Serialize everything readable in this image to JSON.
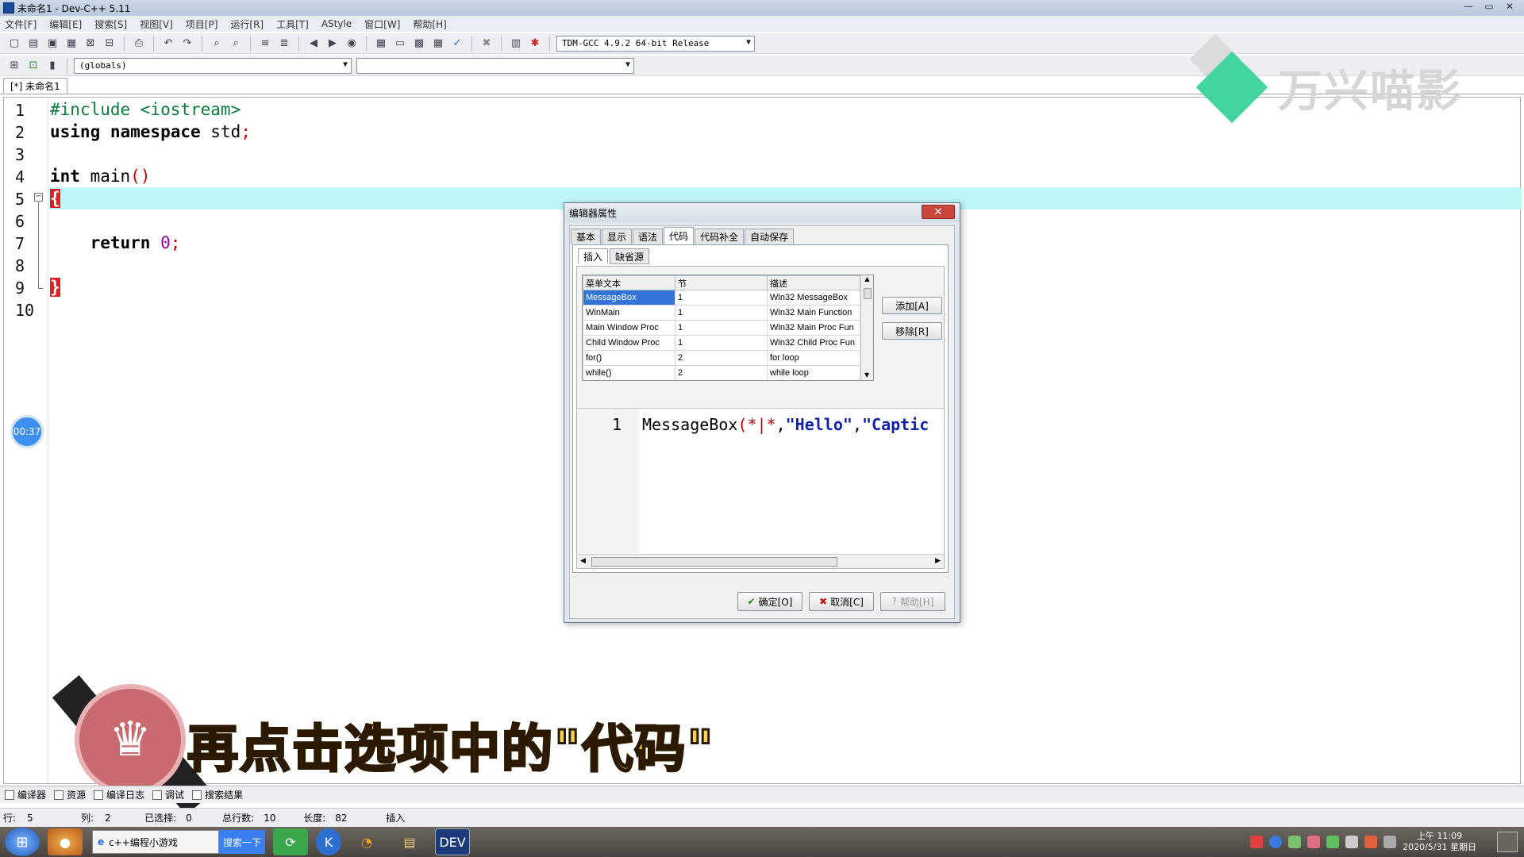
{
  "window": {
    "title": "未命名1 - Dev-C++ 5.11",
    "buttons": [
      "—",
      "▭",
      "✕"
    ]
  },
  "menu": [
    "文件[F]",
    "编辑[E]",
    "搜索[S]",
    "视图[V]",
    "项目[P]",
    "运行[R]",
    "工具[T]",
    "AStyle",
    "窗口[W]",
    "帮助[H]"
  ],
  "toolbar": {
    "compiler": "TDM-GCC 4.9.2 64-bit Release",
    "scope": "(globals)"
  },
  "editor": {
    "tab": "[*] 未命名1",
    "lines": [
      {
        "n": "1"
      },
      {
        "n": "2"
      },
      {
        "n": "3"
      },
      {
        "n": "4"
      },
      {
        "n": "5"
      },
      {
        "n": "6"
      },
      {
        "n": "7"
      },
      {
        "n": "8"
      },
      {
        "n": "9"
      },
      {
        "n": "10"
      }
    ],
    "code": {
      "l1": "#include <iostream>",
      "l2_kw": "using namespace",
      "l2_rest": " std",
      "l2_semi": ";",
      "l4_kw": "int",
      "l4_rest": " main",
      "l4_paren": "()",
      "l5": "{",
      "l7_kw": "return",
      "l7_num": "0",
      "l7_semi": ";",
      "l9": "}"
    },
    "timer": "00:37"
  },
  "watermark": "万兴喵影",
  "dialog": {
    "title": "编辑器属性",
    "close": "✕",
    "tabs": [
      "基本",
      "显示",
      "语法",
      "代码",
      "代码补全",
      "自动保存"
    ],
    "active_tab": "代码",
    "subtabs": [
      "插入",
      "缺省源"
    ],
    "table": {
      "headers": [
        "菜单文本",
        "节",
        "描述"
      ],
      "rows": [
        [
          "MessageBox",
          "1",
          "Win32 MessageBox"
        ],
        [
          "WinMain",
          "1",
          "Win32 Main Function"
        ],
        [
          "Main Window Proc",
          "1",
          "Win32 Main Proc Fun"
        ],
        [
          "Child Window Proc",
          "1",
          "Win32 Child Proc Fun"
        ],
        [
          "for()",
          "2",
          "for loop"
        ],
        [
          "while()",
          "2",
          "while loop"
        ]
      ]
    },
    "add_button": "添加[A]",
    "remove_button": "移除[R]",
    "preview": {
      "line": "1",
      "fn": "MessageBox",
      "open": "(",
      "a1": "*|*",
      "comma1": ",",
      "s1": "\"Hello\"",
      "comma2": ",",
      "s2": "\"Captic"
    },
    "ok": "确定[O]",
    "cancel": "取消[C]",
    "help": "帮助[H]"
  },
  "subtitle": "再点击选项中的\"代码\"",
  "bottom_tabs": [
    "编译器",
    "资源",
    "编译日志",
    "调试",
    "搜索结果"
  ],
  "status": {
    "row_label": "行:",
    "row": "5",
    "col_label": "列:",
    "col": "2",
    "sel_label": "已选择:",
    "sel": "0",
    "total_label": "总行数:",
    "total": "10",
    "len_label": "长度:",
    "len": "82",
    "mode": "插入"
  },
  "taskbar": {
    "search_text": "c++编程小游戏",
    "search_button": "搜索一下",
    "clock_time": "上午 11:09",
    "clock_date": "2020/5/31 星期日"
  }
}
